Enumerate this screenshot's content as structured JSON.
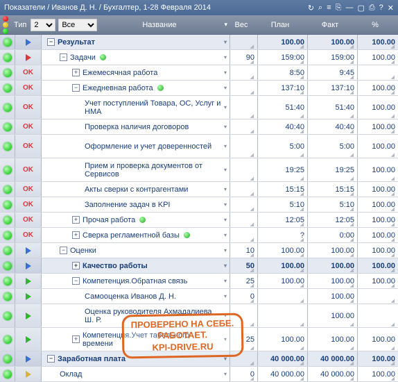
{
  "window": {
    "title": "Показатели / Иванов Д. Н. / Бухгалтер, 1-28 Февраля 2014"
  },
  "toolbar": {
    "tip_label": "Тип",
    "level_select": "2",
    "filter_select": "Все",
    "name_header": "Название"
  },
  "columns": {
    "ves": "Вес",
    "plan": "План",
    "fact": "Факт",
    "pct": "%"
  },
  "stamp": {
    "line1": "ПРОВЕРЕНО НА СЕБЕ.",
    "line2": "РАБОТАЕТ.",
    "line3": "KPI-DRIVE.RU"
  },
  "rows": [
    {
      "status": "green",
      "type": "tri-blue",
      "group": true,
      "indent": 1,
      "exp": "-",
      "name": "Результат",
      "ves": "",
      "plan": "100.00",
      "fact": "100.00",
      "pct": "100.00"
    },
    {
      "status": "green",
      "type": "tri-red",
      "group": false,
      "indent": 2,
      "exp": "-",
      "name": "Задачи",
      "taskdot": true,
      "ves": "90",
      "plan": "159:00",
      "fact": "159:00",
      "pct": "100.00"
    },
    {
      "status": "green",
      "type": "OK",
      "group": false,
      "indent": 3,
      "exp": "+",
      "name": "Ежемесячная работа",
      "ves": "",
      "plan": "8:50",
      "fact": "9:45",
      "pct": ""
    },
    {
      "status": "green",
      "type": "OK",
      "group": false,
      "indent": 3,
      "exp": "-",
      "name": "Ежедневная работа",
      "taskdot": true,
      "ves": "",
      "plan": "137:10",
      "fact": "137:10",
      "pct": "100.00"
    },
    {
      "status": "green",
      "type": "OK",
      "group": false,
      "indent": 4,
      "exp": "",
      "name": "Учет поступлений Товара, ОС, Услуг и НМА",
      "tall": true,
      "ves": "",
      "plan": "51:40",
      "fact": "51:40",
      "pct": "100.00"
    },
    {
      "status": "green",
      "type": "OK",
      "group": false,
      "indent": 4,
      "exp": "",
      "name": "Проверка наличия договоров",
      "ves": "",
      "plan": "40:40",
      "fact": "40:40",
      "pct": "100.00"
    },
    {
      "status": "green",
      "type": "OK",
      "group": false,
      "indent": 4,
      "exp": "",
      "name": "Оформление и учет доверенностей",
      "tall": true,
      "ves": "",
      "plan": "5:00",
      "fact": "5:00",
      "pct": "100.00"
    },
    {
      "status": "green",
      "type": "OK",
      "group": false,
      "indent": 4,
      "exp": "",
      "name": "Прием и проверка документов от Сервисов",
      "tall": true,
      "ves": "",
      "plan": "19:25",
      "fact": "19:25",
      "pct": "100.00"
    },
    {
      "status": "green",
      "type": "OK",
      "group": false,
      "indent": 4,
      "exp": "",
      "name": "Акты сверки с контрагентами",
      "ves": "",
      "plan": "15:15",
      "fact": "15:15",
      "pct": "100.00"
    },
    {
      "status": "green",
      "type": "OK",
      "group": false,
      "indent": 4,
      "exp": "",
      "name": "Заполнение задач в KPI",
      "ves": "",
      "plan": "5:10",
      "fact": "5:10",
      "pct": "100.00"
    },
    {
      "status": "green",
      "type": "OK",
      "group": false,
      "indent": 3,
      "exp": "+",
      "name": "Прочая работа",
      "taskdot": true,
      "ves": "",
      "plan": "12:05",
      "fact": "12:05",
      "pct": "100.00"
    },
    {
      "status": "green",
      "type": "OK",
      "group": false,
      "indent": 3,
      "exp": "+",
      "name": "Сверка регламентной базы",
      "taskdot": true,
      "ves": "",
      "plan": "?",
      "fact": "0:00",
      "pct": "100.00"
    },
    {
      "status": "green",
      "type": "tri-blue",
      "group": false,
      "indent": 2,
      "exp": "-",
      "name": "Оценки",
      "ves": "10",
      "plan": "100.00",
      "fact": "100.00",
      "pct": "100.00"
    },
    {
      "status": "green",
      "type": "tri-blue",
      "group": true,
      "indent": 3,
      "exp": "+",
      "name": "Качество работы",
      "ves": "50",
      "plan": "100.00",
      "fact": "100.00",
      "pct": "100.00"
    },
    {
      "status": "green",
      "type": "tri-green",
      "group": false,
      "indent": 3,
      "exp": "-",
      "name": "Компетенция.Обратная связь",
      "ves": "25",
      "plan": "100.00",
      "fact": "100.00",
      "pct": "100.00"
    },
    {
      "status": "green",
      "type": "tri-green",
      "group": false,
      "indent": 4,
      "exp": "",
      "name": "Самооценка Иванов Д. Н.",
      "ves": "0",
      "plan": "",
      "fact": "100.00",
      "pct": ""
    },
    {
      "status": "green",
      "type": "tri-green",
      "group": false,
      "indent": 4,
      "exp": "",
      "name": "Оценка руководителя Ахмадалиева Ш. Р.",
      "tall": true,
      "ves": "",
      "plan": "",
      "fact": "100.00",
      "pct": ""
    },
    {
      "status": "green",
      "type": "tri-green",
      "group": false,
      "indent": 3,
      "exp": "+",
      "name": "Компетенция.Учет табельного времени",
      "tall": true,
      "ves": "25",
      "plan": "100.00",
      "fact": "100.00",
      "pct": "100.00"
    },
    {
      "status": "green",
      "type": "tri-blue",
      "group": true,
      "indent": 1,
      "exp": "-",
      "name": "Заработная плата",
      "ves": "",
      "plan": "40 000.00",
      "fact": "40 000.00",
      "pct": "100.00"
    },
    {
      "status": "green",
      "type": "tri-yellow",
      "group": false,
      "indent": 2,
      "exp": "",
      "name": "Оклад",
      "ves": "0",
      "plan": "40 000.00",
      "fact": "40 000.00",
      "pct": "100.00"
    }
  ]
}
